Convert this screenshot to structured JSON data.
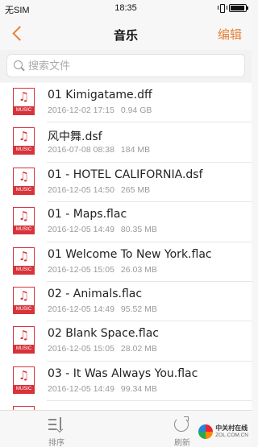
{
  "status_bar": {
    "carrier": "无SIM",
    "time": "18:35"
  },
  "nav": {
    "title": "音乐",
    "edit_label": "编辑"
  },
  "search": {
    "placeholder": "搜索文件",
    "value": ""
  },
  "files": [
    {
      "name": "01 Kimigatame.dff",
      "date": "2016-12-02 17:15",
      "size": "0.94 GB"
    },
    {
      "name": "风中舞.dsf",
      "date": "2016-07-08 08:38",
      "size": "184 MB"
    },
    {
      "name": "01 - HOTEL CALIFORNIA.dsf",
      "date": "2016-12-05 14:50",
      "size": "265 MB"
    },
    {
      "name": "01 - Maps.flac",
      "date": "2016-12-05 14:49",
      "size": "80.35 MB"
    },
    {
      "name": "01 Welcome To New York.flac",
      "date": "2016-12-05 15:05",
      "size": "26.03 MB"
    },
    {
      "name": "02 - Animals.flac",
      "date": "2016-12-05 14:49",
      "size": "95.52 MB"
    },
    {
      "name": "02 Blank Space.flac",
      "date": "2016-12-05 15:05",
      "size": "28.02 MB"
    },
    {
      "name": "03 - It Was Always You.flac",
      "date": "2016-12-05 14:49",
      "size": "99.34 MB"
    },
    {
      "name": "",
      "date": "",
      "size": ""
    }
  ],
  "file_icon": {
    "tag": "MUSIC",
    "note": "♫",
    "color": "#d8323a"
  },
  "toolbar": {
    "sort_label": "排序",
    "refresh_label": "刷新"
  },
  "watermark": {
    "line1": "中关村在线",
    "line2": "ZOL.COM.CN"
  },
  "colors": {
    "accent": "#e8823a",
    "music_red": "#d8323a"
  }
}
